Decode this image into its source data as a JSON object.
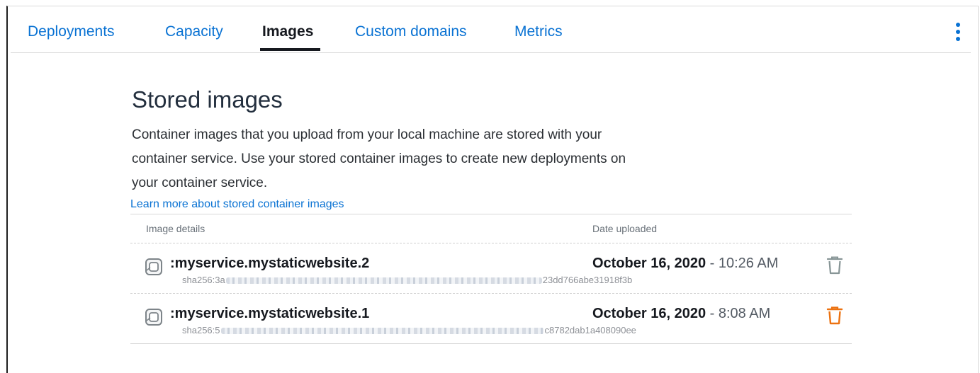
{
  "tabs": [
    {
      "label": "Deployments",
      "active": false
    },
    {
      "label": "Capacity",
      "active": false
    },
    {
      "label": "Images",
      "active": true
    },
    {
      "label": "Custom domains",
      "active": false
    },
    {
      "label": "Metrics",
      "active": false
    }
  ],
  "section": {
    "title": "Stored images",
    "description_lines": [
      "Container images that you upload from your local machine are stored with your",
      "container service. Use your stored container images to create new deployments on",
      "your container service."
    ],
    "learn_more_link": "Learn more about stored container images"
  },
  "table": {
    "columns": {
      "image_details": "Image details",
      "date_uploaded": "Date uploaded"
    },
    "rows": [
      {
        "name": ":myservice.mystaticwebsite.2",
        "sha_prefix": "sha256:3a",
        "sha_suffix": "23dd766abe31918f3b",
        "date": "October 16, 2020",
        "date_separator": " - ",
        "time": "10:26 AM",
        "delete_icon": "trash-icon",
        "delete_color": "#879596"
      },
      {
        "name": ":myservice.mystaticwebsite.1",
        "sha_prefix": "sha256:5",
        "sha_suffix": "c8782dab1a408090ee",
        "date": "October 16, 2020",
        "date_separator": " - ",
        "time": "8:08 AM",
        "delete_icon": "trash-icon",
        "delete_color": "#ec7211"
      }
    ]
  },
  "colors": {
    "link": "#0972d3",
    "text": "#16191f",
    "accent_orange": "#ec7211"
  },
  "icons": {
    "menu": "more-vertical-icon",
    "image": "container-image-icon"
  }
}
